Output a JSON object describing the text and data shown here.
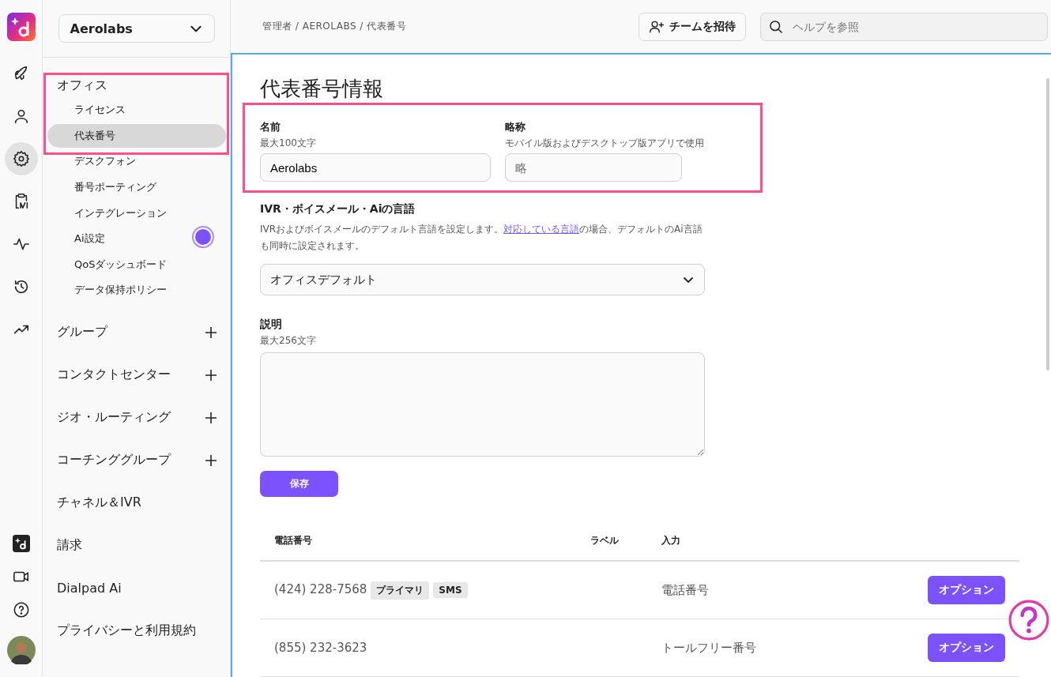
{
  "rail_items": [
    {
      "kind": "rocket",
      "selected": false
    },
    {
      "kind": "person",
      "selected": false
    },
    {
      "kind": "gear",
      "selected": true
    },
    {
      "kind": "clipboard",
      "selected": false
    },
    {
      "kind": "pulse",
      "selected": false
    },
    {
      "kind": "history",
      "selected": false
    },
    {
      "kind": "trend",
      "selected": false
    }
  ],
  "rail_bottom": [
    {
      "kind": "ai"
    },
    {
      "kind": "video"
    },
    {
      "kind": "help"
    }
  ],
  "org_selector": {
    "value": "Aerolabs"
  },
  "sidebar": {
    "group_label": "オフィス",
    "items": [
      {
        "label": "ライセンス",
        "selected": false
      },
      {
        "label": "代表番号",
        "selected": true
      },
      {
        "label": "デスクフォン",
        "selected": false
      },
      {
        "label": "番号ポーティング",
        "selected": false
      },
      {
        "label": "インテグレーション",
        "selected": false
      },
      {
        "label": "Ai設定",
        "selected": false
      },
      {
        "label": "QoSダッシュボード",
        "selected": false
      },
      {
        "label": "データ保持ポリシー",
        "selected": false
      }
    ],
    "sections": [
      {
        "label": "グループ",
        "expandable": true
      },
      {
        "label": "コンタクトセンター",
        "expandable": true
      },
      {
        "label": "ジオ・ルーティング",
        "expandable": true
      },
      {
        "label": "コーチンググループ",
        "expandable": true
      },
      {
        "label": "チャネル＆IVR",
        "expandable": false
      },
      {
        "label": "請求",
        "expandable": false
      },
      {
        "label": "Dialpad Ai",
        "expandable": false
      },
      {
        "label": "プライバシーと利用規約",
        "expandable": false
      }
    ]
  },
  "breadcrumb": "管理者 / AEROLABS / 代表番号",
  "invite_button": "チームを招待",
  "search": {
    "placeholder": "ヘルプを参照"
  },
  "title": "代表番号情報",
  "name_field": {
    "label": "名前",
    "hint": "最大100文字",
    "value": "Aerolabs"
  },
  "short_field": {
    "label": "略称",
    "hint": "モバイル版およびデスクトップ版アプリで使用",
    "placeholder": "略"
  },
  "language": {
    "label": "IVR・ボイスメール・Aiの言語",
    "text_before": "IVRおよびボイスメールのデフォルト言語を設定します。",
    "link": "対応している言語",
    "text_after": "の場合、デフォルトのAi言語も同時に設定されます。",
    "value": "オフィスデフォルト"
  },
  "description": {
    "label": "説明",
    "hint": "最大256文字"
  },
  "save_button": "保存",
  "table": {
    "columns": [
      "電話番号",
      "ラベル",
      "入力"
    ],
    "rows": [
      {
        "number": "(424) 228-7568",
        "tags": [
          "プライマリ",
          "SMS"
        ],
        "type": "電話番号",
        "action": "オプション"
      },
      {
        "number": "(855) 232-3623",
        "tags": [],
        "type": "トールフリー番号",
        "action": "オプション"
      }
    ]
  }
}
